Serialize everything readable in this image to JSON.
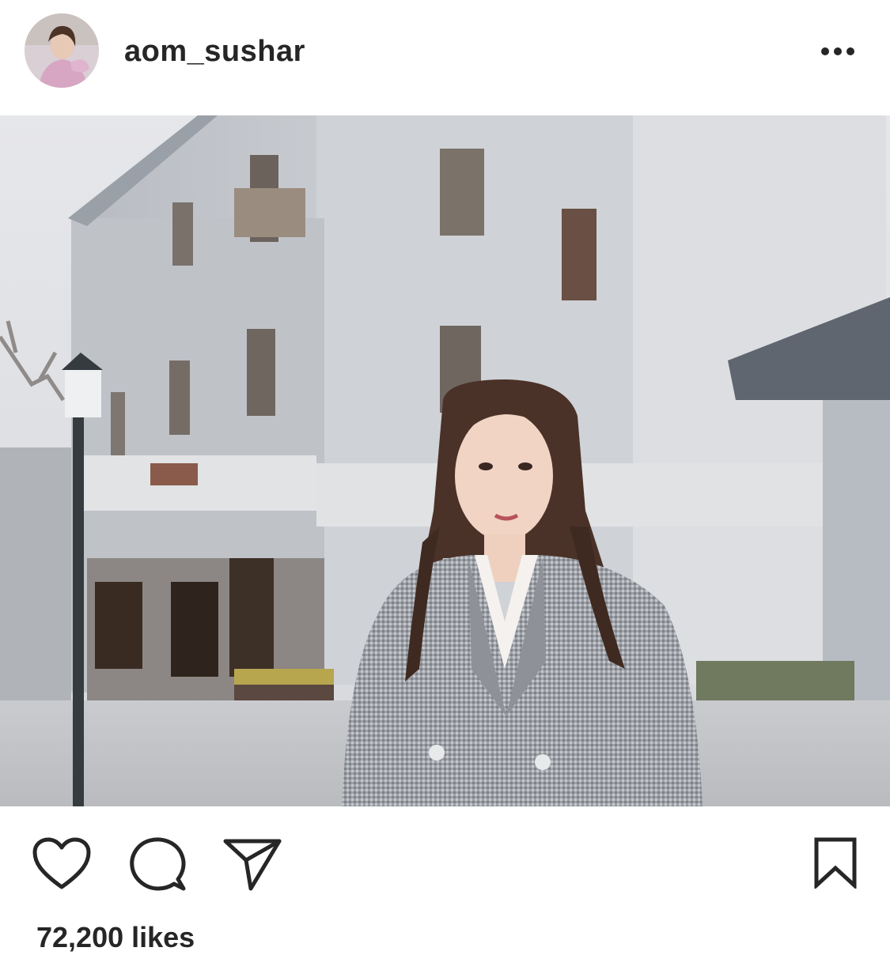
{
  "post": {
    "username": "aom_sushar",
    "likes_text": "72,200 likes"
  },
  "header": {
    "avatar_icon": "profile-photo",
    "more_icon": "more-horizontal-icon"
  },
  "actions": {
    "like_icon": "heart-icon",
    "comment_icon": "comment-bubble-icon",
    "share_icon": "paper-plane-icon",
    "save_icon": "bookmark-icon"
  },
  "colors": {
    "text": "#262626",
    "background": "#ffffff"
  }
}
